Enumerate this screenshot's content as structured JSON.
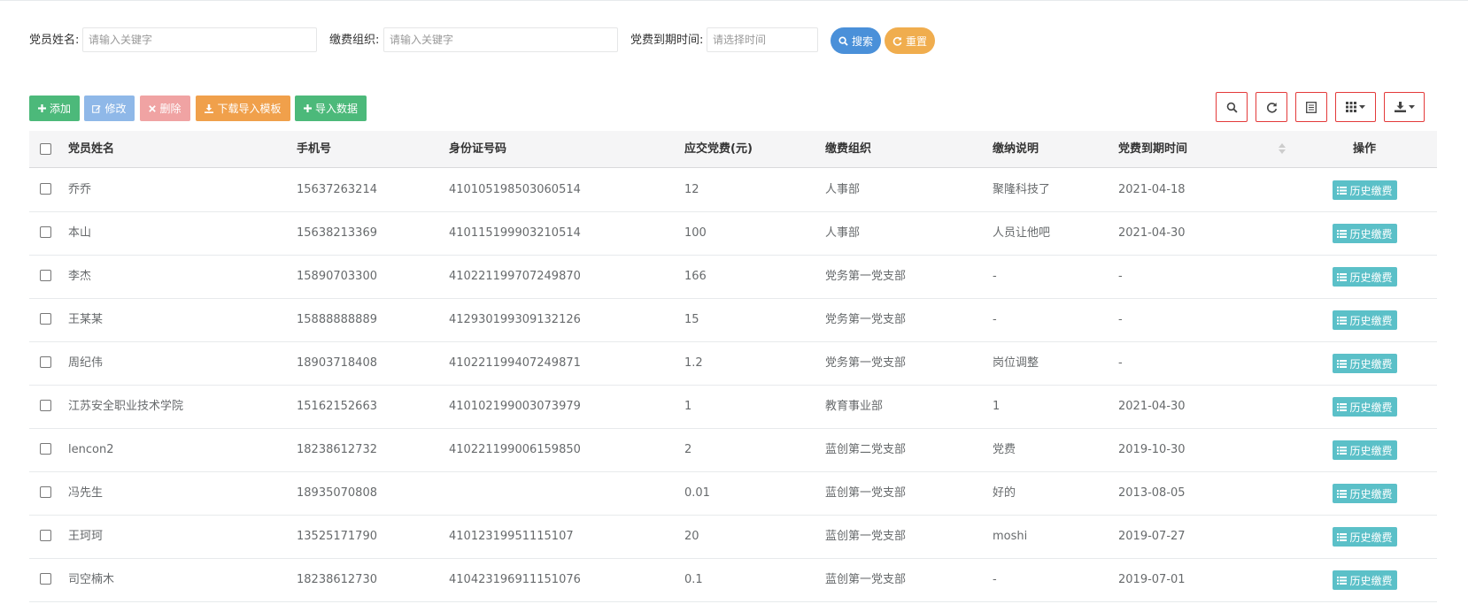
{
  "search": {
    "name_label": "党员姓名:",
    "name_placeholder": "请输入关键字",
    "org_label": "缴费组织:",
    "org_placeholder": "请输入关键字",
    "expire_label": "党费到期时间:",
    "expire_placeholder": "请选择时间",
    "search_button": "搜索",
    "reset_button": "重置"
  },
  "toolbar": {
    "add": "添加",
    "edit": "修改",
    "delete": "删除",
    "download_template": "下载导入模板",
    "import_data": "导入数据"
  },
  "table": {
    "headers": [
      "党员姓名",
      "手机号",
      "身份证号码",
      "应交党费(元)",
      "缴费组织",
      "缴纳说明",
      "党费到期时间",
      "操作"
    ],
    "action_label": "历史缴费",
    "rows": [
      {
        "name": "乔乔",
        "phone": "15637263214",
        "id": "410105198503060514",
        "fee": "12",
        "org": "人事部",
        "note": "聚隆科技了",
        "expire": "2021-04-18"
      },
      {
        "name": "本山",
        "phone": "15638213369",
        "id": "410115199903210514",
        "fee": "100",
        "org": "人事部",
        "note": "人员让他吧",
        "expire": "2021-04-30"
      },
      {
        "name": "李杰",
        "phone": "15890703300",
        "id": "410221199707249870",
        "fee": "166",
        "org": "党务第一党支部",
        "note": "-",
        "expire": "-"
      },
      {
        "name": "王某某",
        "phone": "15888888889",
        "id": "412930199309132126",
        "fee": "15",
        "org": "党务第一党支部",
        "note": "-",
        "expire": "-"
      },
      {
        "name": "周纪伟",
        "phone": "18903718408",
        "id": "410221199407249871",
        "fee": "1.2",
        "org": "党务第一党支部",
        "note": "岗位调整",
        "expire": "-"
      },
      {
        "name": "江苏安全职业技术学院",
        "phone": "15162152663",
        "id": "410102199003073979",
        "fee": "1",
        "org": "教育事业部",
        "note": "1",
        "expire": "2021-04-30"
      },
      {
        "name": "lencon2",
        "phone": "18238612732",
        "id": "410221199006159850",
        "fee": "2",
        "org": "蓝创第二党支部",
        "note": "党费",
        "expire": "2019-10-30"
      },
      {
        "name": "冯先生",
        "phone": "18935070808",
        "id": "",
        "fee": "0.01",
        "org": "蓝创第一党支部",
        "note": "好的",
        "expire": "2013-08-05"
      },
      {
        "name": "王珂珂",
        "phone": "13525171790",
        "id": "41012319951115107",
        "fee": "20",
        "org": "蓝创第一党支部",
        "note": "moshi",
        "expire": "2019-07-27"
      },
      {
        "name": "司空楠木",
        "phone": "18238612730",
        "id": "410423196911151076",
        "fee": "0.1",
        "org": "蓝创第一党支部",
        "note": "-",
        "expire": "2019-07-01"
      }
    ]
  },
  "colors": {
    "primary": "#4a90d9",
    "warning": "#f0ad4e",
    "success": "#4cb97a",
    "danger_light": "#f0a3a3",
    "info": "#5bc0c8",
    "highlight_border": "#e33a3a"
  }
}
